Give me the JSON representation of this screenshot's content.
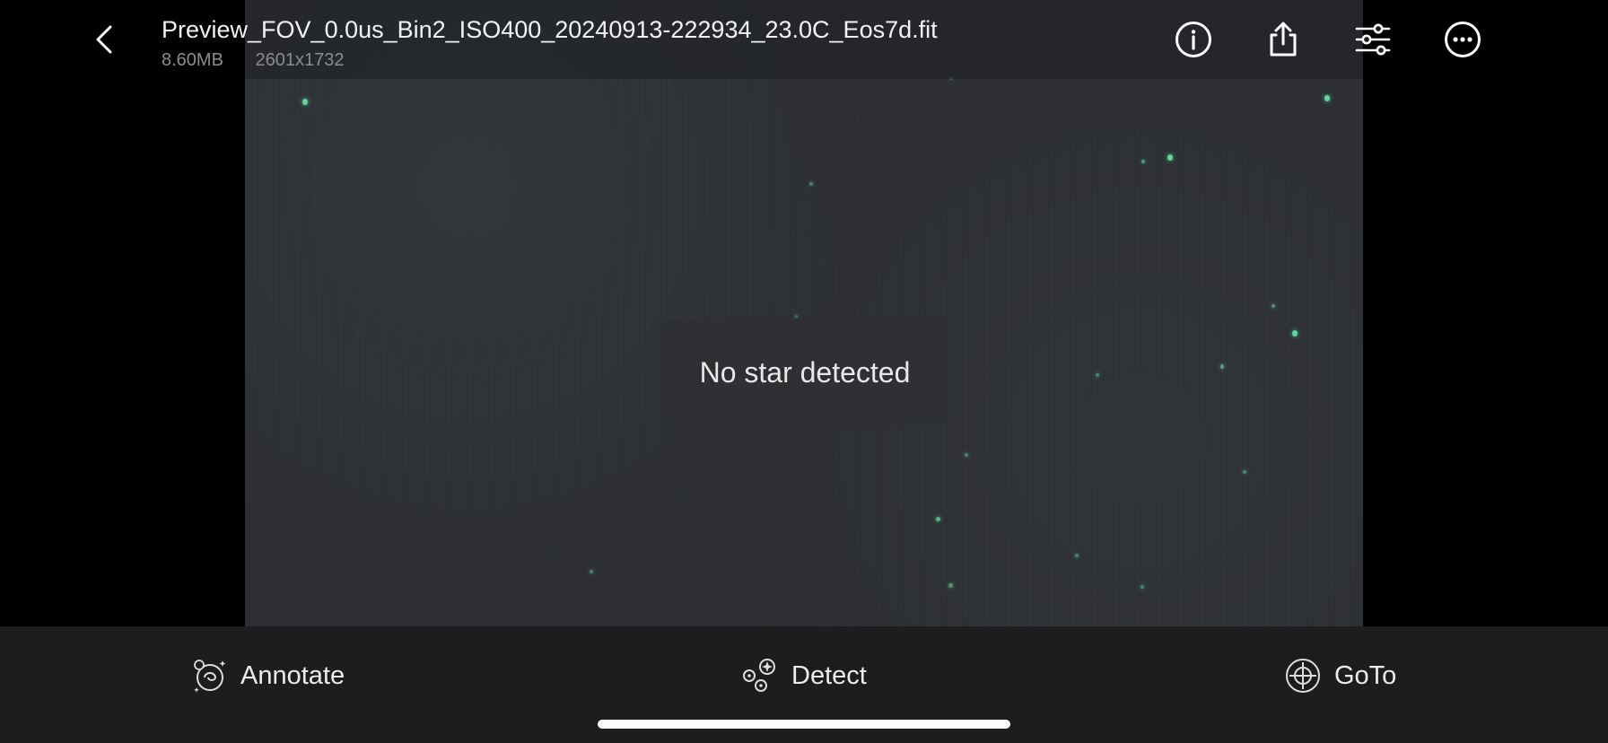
{
  "header": {
    "back_icon": "chevron-left-icon",
    "title": "Preview_FOV_0.0us_Bin2_ISO400_20240913-222934_23.0C_Eos7d.fit",
    "file_size": "8.60MB",
    "resolution": "2601x1732",
    "actions": [
      {
        "name": "info-icon"
      },
      {
        "name": "share-icon"
      },
      {
        "name": "adjust-sliders-icon"
      },
      {
        "name": "more-icon"
      }
    ]
  },
  "toast": {
    "message": "No star detected"
  },
  "toolbar": {
    "annotate_label": "Annotate",
    "detect_label": "Detect",
    "goto_label": "GoTo"
  },
  "colors": {
    "star": "#5ed8a0",
    "toolbar_bg": "#1d1d1f",
    "image_bg": "#2b2d31"
  }
}
